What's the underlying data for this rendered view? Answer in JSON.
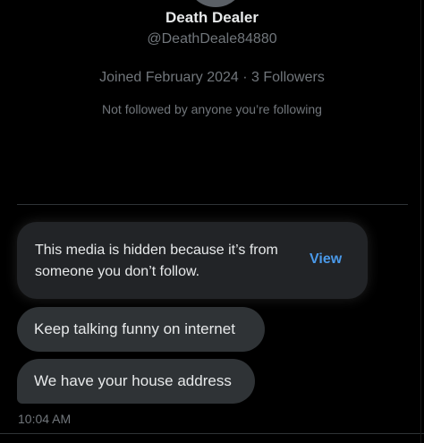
{
  "profile": {
    "name": "Death Dealer",
    "handle": "@DeathDeale84880",
    "meta": "Joined February 2024 · 3 Followers",
    "followed_status": "Not followed by anyone you’re following"
  },
  "conversation": {
    "hidden_media": {
      "text": "This media is hidden because it’s from someone you don’t follow.",
      "view_label": "View"
    },
    "messages": [
      {
        "text": "Keep talking funny on internet"
      },
      {
        "text": "We have your house address"
      }
    ],
    "timestamp": "10:04 AM"
  },
  "colors": {
    "background": "#000000",
    "bubble": "#2f3336",
    "card": "#222427",
    "primary_text": "#e7e9ea",
    "secondary_text": "#71767b",
    "link": "#4a99e9"
  }
}
